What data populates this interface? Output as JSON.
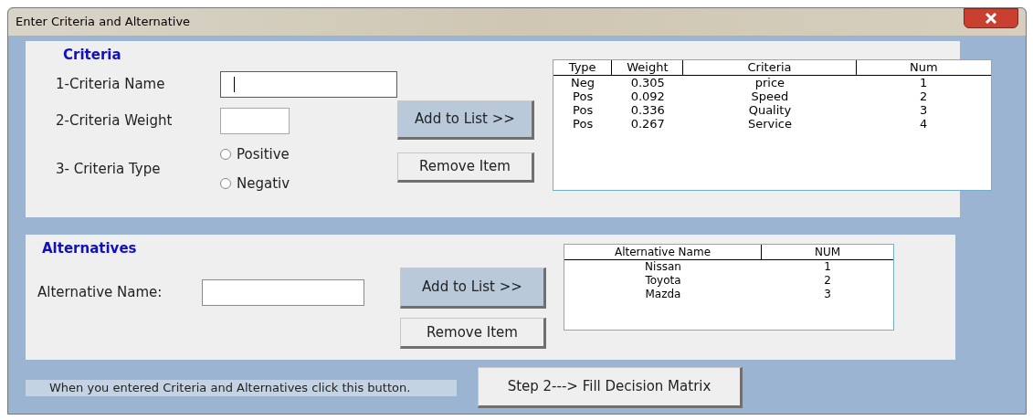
{
  "window": {
    "title": "Enter Criteria and Alternative"
  },
  "criteria": {
    "heading": "Criteria",
    "fields": [
      {
        "label": "1-Criteria Name",
        "kind": "wide",
        "focused": true
      },
      {
        "label": "2-Criteria Weight",
        "kind": "narrow",
        "focused": false
      }
    ],
    "type_label": "3- Criteria Type",
    "types": [
      {
        "label": "Positive",
        "selected": false
      },
      {
        "label": "Negativ",
        "selected": false
      }
    ],
    "add_button": "Add to List >>",
    "remove_button": "Remove Item",
    "table": {
      "columns": [
        "Type",
        "Weight",
        "Criteria",
        "Num"
      ],
      "rows": [
        [
          "Neg",
          "0.305",
          "price",
          "1"
        ],
        [
          "Pos",
          "0.092",
          "Speed",
          "2"
        ],
        [
          "Pos",
          "0.336",
          "Quality",
          "3"
        ],
        [
          "Pos",
          "0.267",
          "Service",
          "4"
        ]
      ]
    }
  },
  "alternatives": {
    "heading": "Alternatives",
    "field_label": "Alternative Name:",
    "add_button": "Add to List  >>",
    "remove_button": "Remove Item",
    "table": {
      "columns": [
        "Alternative Name",
        "NUM"
      ],
      "rows": [
        [
          "Nissan",
          "1"
        ],
        [
          "Toyota",
          "2"
        ],
        [
          "Mazda",
          "3"
        ]
      ]
    }
  },
  "footer": {
    "hint": "When you entered Criteria and Alternatives click this button.",
    "button": "Step 2---> Fill Decision Matrix"
  }
}
